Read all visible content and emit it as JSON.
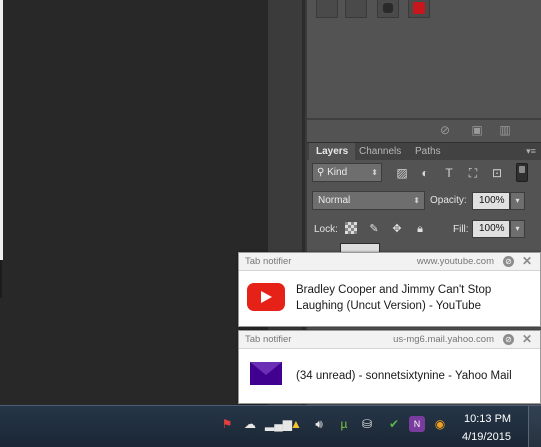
{
  "layers_panel": {
    "tabs": [
      {
        "label": "Layers",
        "active": true
      },
      {
        "label": "Channels",
        "active": false
      },
      {
        "label": "Paths",
        "active": false
      }
    ],
    "filter": {
      "kind_label": "Kind"
    },
    "blend_mode": "Normal",
    "opacity_label": "Opacity:",
    "opacity_value": "100%",
    "lock_label": "Lock:",
    "fill_label": "Fill:",
    "fill_value": "100%"
  },
  "notifications": [
    {
      "app": "Tab notifier",
      "source": "www.youtube.com",
      "icon": "youtube-icon",
      "lines": [
        "Bradley Cooper and Jimmy Can't Stop",
        "Laughing (Uncut Version) - YouTube"
      ]
    },
    {
      "app": "Tab notifier",
      "source": "us-mg6.mail.yahoo.com",
      "icon": "yahoo-mail-icon",
      "lines": [
        "(34 unread) - sonnetsixtynine - Yahoo Mail"
      ]
    }
  ],
  "taskbar": {
    "time": "10:13 PM",
    "date": "4/19/2015",
    "tray_icons": [
      "flag-icon",
      "cloud-icon",
      "network-bars-icon",
      "google-drive-icon",
      "volume-icon",
      "utorrent-icon",
      "usb-icon",
      "shield-check-icon",
      "onenote-icon",
      "orange-circle-icon"
    ]
  },
  "colors": {
    "panel_bg": "#535353",
    "taskbar_bg": "#1f2d3d",
    "youtube_red": "#e62117",
    "yahoo_purple": "#400090"
  }
}
